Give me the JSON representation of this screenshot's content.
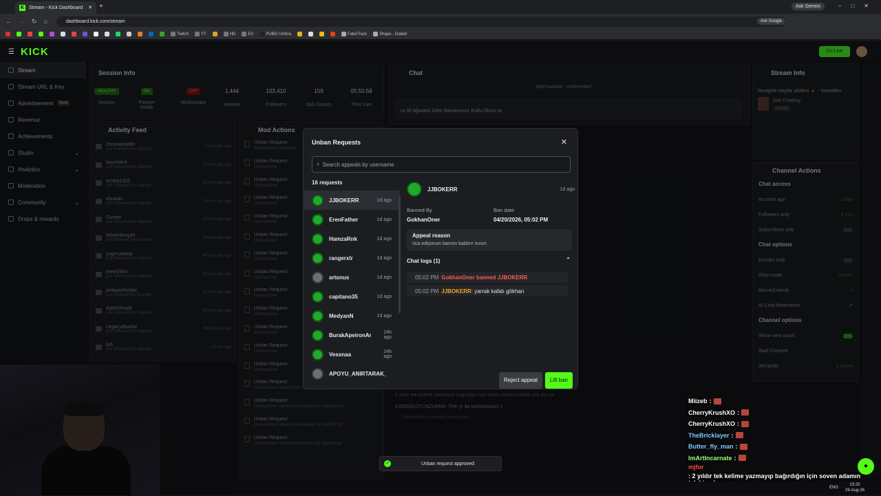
{
  "browser": {
    "tab_title": "Stream - Kick Dashboard",
    "url": "dashboard.kick.com/stream",
    "ask_gemini": "Ask Gemini",
    "ask_google": "Ask Google",
    "bookmarks": [
      "Twitch",
      "YT",
      "HD",
      "EV",
      "PUBG Umbra",
      "FakeTruck",
      "Shape - Dialed"
    ]
  },
  "kick": {
    "logo": "KICK",
    "go_live": "Go Live"
  },
  "sidebar": {
    "items": [
      {
        "label": "Stream",
        "active": true
      },
      {
        "label": "Stream URL & Key"
      },
      {
        "label": "Advertisement",
        "tag": "Beta"
      },
      {
        "label": "Revenue"
      },
      {
        "label": "Achievements"
      },
      {
        "label": "Studio"
      },
      {
        "label": "Analytics"
      },
      {
        "label": "Moderation"
      },
      {
        "label": "Community"
      },
      {
        "label": "Drops & rewards"
      }
    ]
  },
  "session": {
    "title": "Session Info",
    "stats": [
      {
        "value": "HEALTHY",
        "label": "Session"
      },
      {
        "value": "ON",
        "label": "Partner Inside"
      },
      {
        "value": "OFF",
        "label": "Multistream"
      },
      {
        "value": "1,444",
        "label": "Viewers"
      },
      {
        "value": "103,410",
        "label": "Followers"
      },
      {
        "value": "159",
        "label": "Sub Counts"
      },
      {
        "value": "05:50:58",
        "label": "Time Live"
      }
    ]
  },
  "activity": {
    "title": "Activity Feed",
    "sub": "just followed the channel",
    "rows": [
      {
        "name": "Zeromero890",
        "time": "7 minutes ago"
      },
      {
        "name": "hayrettin4",
        "time": "16 minutes ago"
      },
      {
        "name": "emrtoi1322",
        "time": "23 minutes ago"
      },
      {
        "name": "ebuwan",
        "time": "26 minutes ago"
      },
      {
        "name": "Cwnter",
        "time": "32 minutes ago"
      },
      {
        "name": "heisenberg46",
        "time": "34 minutes ago"
      },
      {
        "name": "yagmurpeep",
        "time": "42 minutes ago"
      },
      {
        "name": "mete3584",
        "time": "53 minutes ago"
      },
      {
        "name": "pinkpantherbic",
        "time": "52 minutes ago"
      },
      {
        "name": "AybrkShade",
        "time": "55 minutes ago"
      },
      {
        "name": "Legacydiyorlar",
        "time": "58 minutes ago"
      },
      {
        "name": "lish",
        "time": "1 hour ago"
      }
    ]
  },
  "mod_actions": {
    "title": "Mod Actions",
    "rows": [
      {
        "t": "Unban Request",
        "s": "GokhanOner approved"
      },
      {
        "t": "Unban Request",
        "s": "GokhanOner"
      },
      {
        "t": "Unban Request",
        "s": "GokhanOner"
      },
      {
        "t": "Unban Request",
        "s": "GokhanOner"
      },
      {
        "t": "Unban Request",
        "s": "GokhanOner"
      },
      {
        "t": "Unban Request",
        "s": "GokhanOner"
      },
      {
        "t": "Unban Request",
        "s": "GokhanOner"
      },
      {
        "t": "Unban Request",
        "s": "GokhanOner"
      },
      {
        "t": "Unban Request",
        "s": "GokhanOner"
      },
      {
        "t": "Unban Request",
        "s": "GokhanOner"
      },
      {
        "t": "Unban Request",
        "s": "GokhanOner"
      },
      {
        "t": "Unban Request",
        "s": "GokhanOner"
      },
      {
        "t": "Unban Request",
        "s": "GokhanOner"
      },
      {
        "t": "Unban Request",
        "s": "GokhanOner rejected the request by Ozyman"
      },
      {
        "t": "Unban Request",
        "s": "GokhanOner rejected the request by Sllyogerman"
      },
      {
        "t": "Unban Request",
        "s": "GokhanOner rejected the request by NorthFPSZ"
      },
      {
        "t": "Unban Request",
        "s": "GokhanOner rejected the request by ogmancdly"
      }
    ]
  },
  "chat": {
    "title": "Chat",
    "pinned_users": [
      "alpersaaslan",
      "mehmedarf"
    ],
    "pinned_msg": "ra 30 Ağustos Zafer Bayramımız Kutlu Olsun ra",
    "lines": [
      "2 yıldır tek kelime yazmayıp bağırdığın için soven adamın talebi yok mu ya",
      "KONSOLOYUNZURNA: THK yı da banlamazsın :)",
      "GokhanOner unbanned Andreyeniya"
    ]
  },
  "stream_info": {
    "title": "Stream Info",
    "stream_title": "Rastgele olaylar silsilesi 🔺 - !sonvideo",
    "category": "Just Chatting",
    "tag": "Turkish"
  },
  "channel_actions": {
    "title": "Channel Actions",
    "sections": [
      {
        "head": "Chat access",
        "rows": [
          {
            "l": "Account age",
            "v": "1 day"
          },
          {
            "l": "Followers only",
            "v": "5 min"
          },
          {
            "l": "Subscribers only",
            "v": ""
          }
        ]
      },
      {
        "head": "Chat options",
        "rows": [
          {
            "l": "Emotes only",
            "v": ""
          },
          {
            "l": "Slow mode",
            "v": "Instant"
          },
          {
            "l": "Banned words",
            "v": ""
          },
          {
            "l": "AI Chat Moderation",
            "v": ""
          }
        ]
      },
      {
        "head": "Channel options",
        "rows": [
          {
            "l": "Show view count",
            "v": ""
          },
          {
            "l": "Raid Channel",
            "v": ""
          },
          {
            "l": "Set goals",
            "v": "1 active"
          }
        ]
      }
    ]
  },
  "modal": {
    "title": "Unban Requests",
    "search_placeholder": "Search appeals by username",
    "count": "16 requests",
    "requests": [
      {
        "name": "JJBOKERR",
        "time": "1d ago"
      },
      {
        "name": "ErenFather",
        "time": "1d ago"
      },
      {
        "name": "HamzaRnk",
        "time": "1d ago"
      },
      {
        "name": "rangerxlr",
        "time": "1d ago"
      },
      {
        "name": "artonus",
        "time": "1d ago"
      },
      {
        "name": "capitano35",
        "time": "1d ago"
      },
      {
        "name": "MedyanN",
        "time": "1d ago"
      },
      {
        "name": "BurakApeironAras",
        "time": "24h ago"
      },
      {
        "name": "Vessnaa",
        "time": "24h ago"
      },
      {
        "name": "APOYU_ANIRTARAK_SIKEN",
        "time": ""
      }
    ],
    "detail": {
      "name": "JJBOKERR",
      "time": "1d ago",
      "banned_by_label": "Banned By",
      "banned_by": "GokhanOner",
      "ban_date_label": "Ban date",
      "ban_date": "04/20/2026, 05:02 PM",
      "appeal_label": "Appeal reason",
      "appeal_text": "rica ediyorum banımı kaldırır mısın",
      "logs_label": "Chat logs (1)",
      "logs": [
        {
          "time": "05:02 PM",
          "who": "GokhanOner banned JJBOKERR",
          "msg": ""
        },
        {
          "time": "05:02 PM",
          "who": "JJBOKERR",
          "msg": ": yarrak kafalı gökhan"
        }
      ]
    },
    "reject_label": "Reject appeal",
    "lift_label": "Lift ban"
  },
  "toast": "Unban request approved",
  "stream_overlay_chat": [
    {
      "name": "Miizeb",
      "color": "#ffffff",
      "msg": ""
    },
    {
      "name": "CherryKrushXO",
      "color": "#ffffff",
      "msg": ""
    },
    {
      "name": "CherryKrushXO",
      "color": "#ffffff",
      "msg": ""
    },
    {
      "name": "TheBricklayer",
      "color": "#7fd0ff",
      "msg": ""
    },
    {
      "name": "Butter_fly_man",
      "color": "#7fd0ff",
      "msg": ""
    },
    {
      "name": "ImArtIncarnate",
      "color": "#a0ff7a",
      "msg": ""
    },
    {
      "name": "mjfor",
      "color": "#ff4b4b",
      "msg": ": 2 yıldır tek kelime yazmayıp bağırdığın için soven adamın talebi yok mu ya"
    },
    {
      "name": "KONSOL0YUNZURNA",
      "color": "#ffffff",
      "msg": ": THK yı da banlamazsın :)"
    }
  ],
  "taskbar": {
    "lang": "ENG",
    "time": "23:25",
    "date": "29-Aug-26"
  }
}
